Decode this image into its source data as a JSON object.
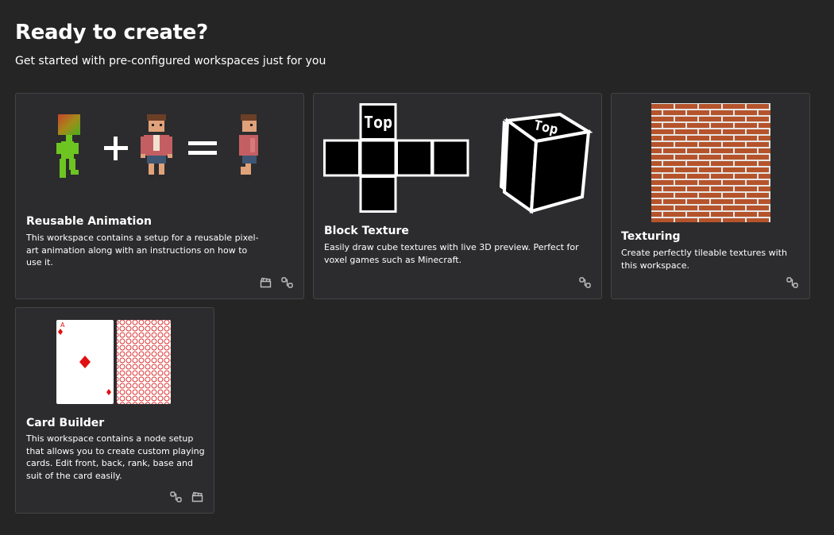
{
  "header": {
    "title": "Ready to create?",
    "subtitle": "Get started with pre-configured workspaces just for you"
  },
  "cards": [
    {
      "title": "Reusable Animation",
      "description": "This workspace contains a setup for a reusable pixel-art animation along with an instructions on how to use it.",
      "icons": [
        "clapperboard-icon",
        "node-graph-icon"
      ]
    },
    {
      "title": "Block Texture",
      "description": "Easily draw cube textures with live 3D preview. Perfect for voxel games such as Minecraft.",
      "preview_label": "Top",
      "icons": [
        "node-graph-icon"
      ]
    },
    {
      "title": "Texturing",
      "description": "Create perfectly tileable textures with this workspace.",
      "icons": [
        "node-graph-icon"
      ]
    },
    {
      "title": "Card Builder",
      "description": "This workspace contains a node setup that allows you to create custom playing cards. Edit front, back, rank, base and suit of the card easily.",
      "preview_rank": "A",
      "icons": [
        "node-graph-icon",
        "clapperboard-icon"
      ]
    }
  ],
  "colors": {
    "background": "#252526",
    "card": "#2c2c2e",
    "brick": "#b5532b",
    "mortar": "#e6e6e6",
    "card_red": "#e01010"
  }
}
